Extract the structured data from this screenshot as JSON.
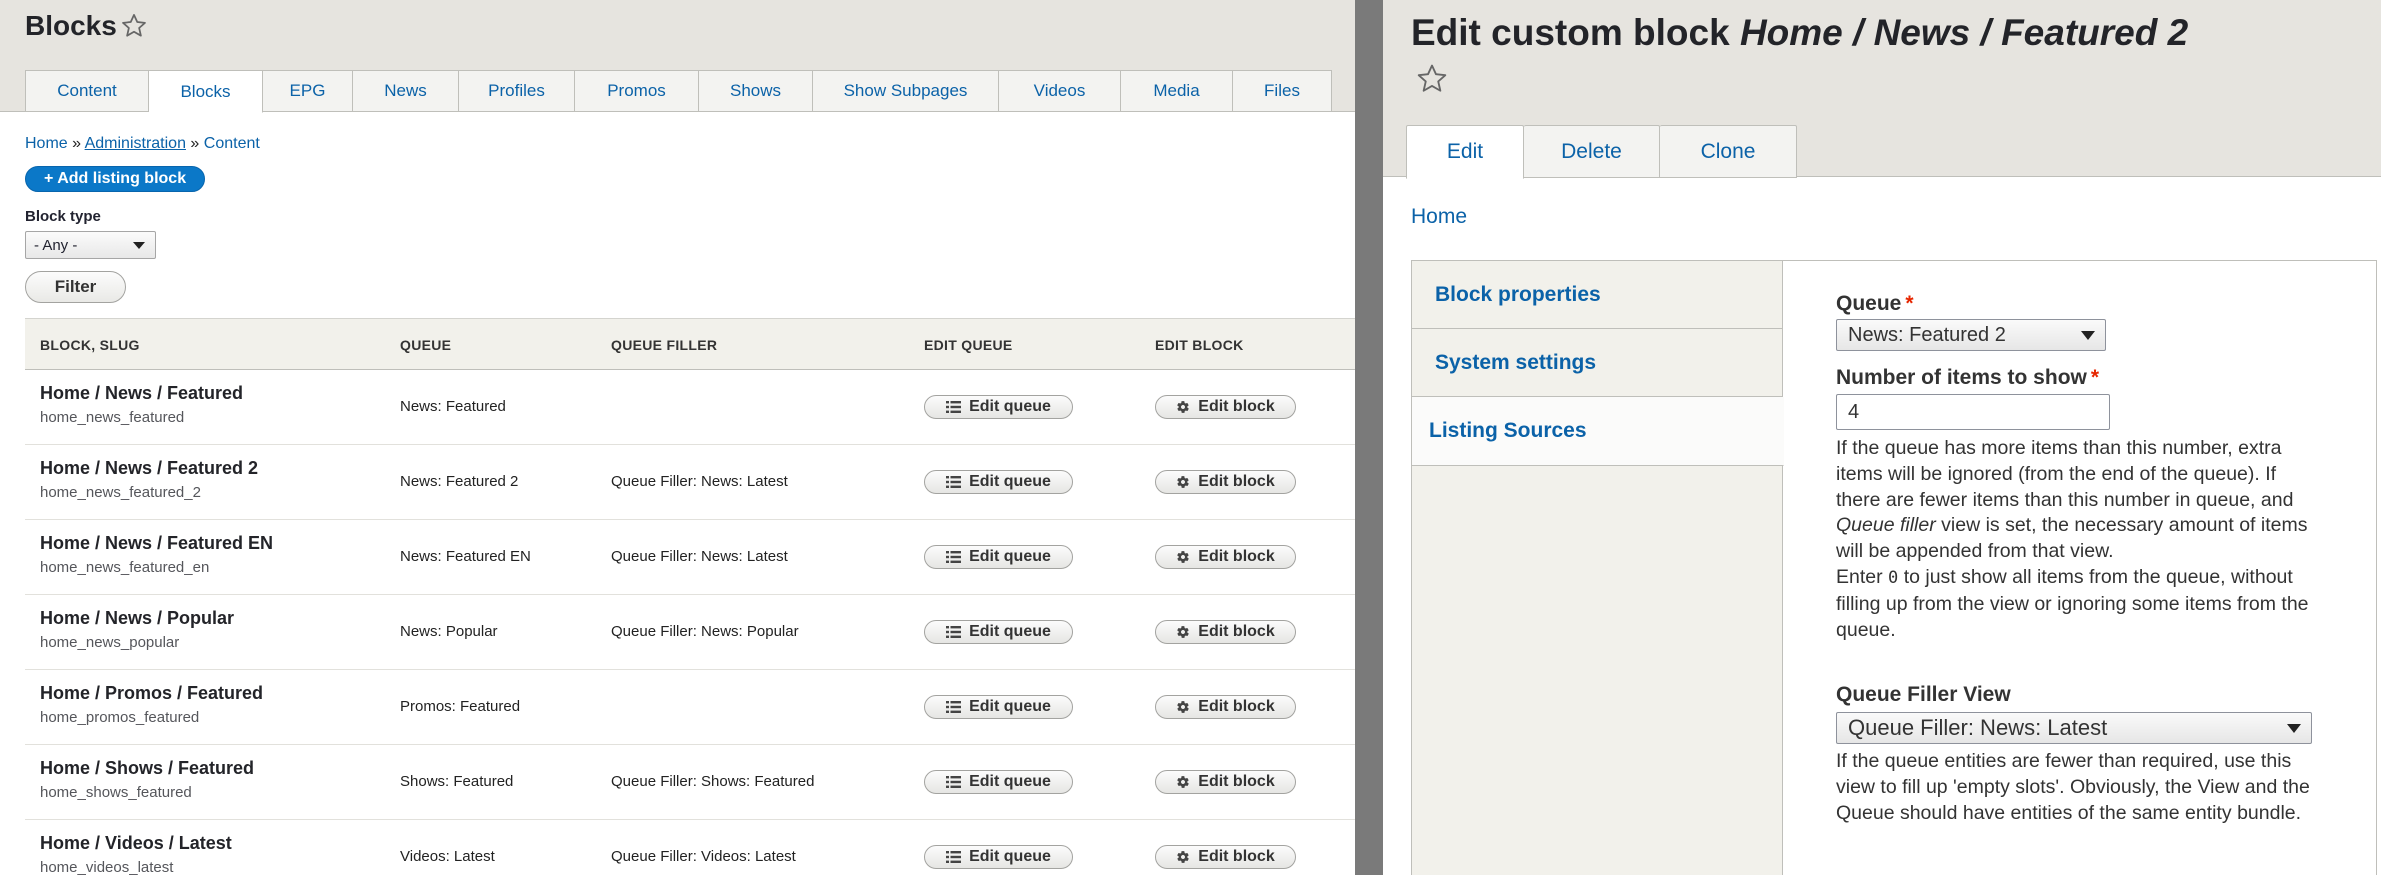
{
  "left": {
    "page_title": "Blocks",
    "tabs": [
      {
        "label": "Content",
        "w": 124
      },
      {
        "label": "Blocks",
        "w": 114,
        "active": true
      },
      {
        "label": "EPG",
        "w": 90
      },
      {
        "label": "News",
        "w": 106
      },
      {
        "label": "Profiles",
        "w": 116
      },
      {
        "label": "Promos",
        "w": 124
      },
      {
        "label": "Shows",
        "w": 114
      },
      {
        "label": "Show Subpages",
        "w": 186
      },
      {
        "label": "Videos",
        "w": 122
      },
      {
        "label": "Media",
        "w": 112
      },
      {
        "label": "Files",
        "w": 99
      }
    ],
    "breadcrumb": {
      "home": "Home",
      "sep1": " » ",
      "admin": "Administration",
      "sep2": " » ",
      "content": "Content"
    },
    "add_listing_label": "+ Add listing block",
    "block_type_label": "Block type",
    "block_type_value": "- Any -",
    "filter_label": "Filter",
    "table": {
      "headers": [
        "BLOCK, SLUG",
        "QUEUE",
        "QUEUE FILLER",
        "EDIT QUEUE",
        "EDIT BLOCK"
      ],
      "rows": [
        {
          "title": "Home / News / Featured",
          "slug": "home_news_featured",
          "queue": "News: Featured",
          "filler": "",
          "edit_queue": "Edit queue",
          "edit_block": "Edit block"
        },
        {
          "title": "Home / News / Featured 2",
          "slug": "home_news_featured_2",
          "queue": "News: Featured 2",
          "filler": "Queue Filler: News: Latest",
          "edit_queue": "Edit queue",
          "edit_block": "Edit block"
        },
        {
          "title": "Home / News / Featured EN",
          "slug": "home_news_featured_en",
          "queue": "News: Featured EN",
          "filler": "Queue Filler: News: Latest",
          "edit_queue": "Edit queue",
          "edit_block": "Edit block"
        },
        {
          "title": "Home / News / Popular",
          "slug": "home_news_popular",
          "queue": "News: Popular",
          "filler": "Queue Filler: News: Popular",
          "edit_queue": "Edit queue",
          "edit_block": "Edit block"
        },
        {
          "title": "Home / Promos / Featured",
          "slug": "home_promos_featured",
          "queue": "Promos: Featured",
          "filler": "",
          "edit_queue": "Edit queue",
          "edit_block": "Edit block"
        },
        {
          "title": "Home / Shows / Featured",
          "slug": "home_shows_featured",
          "queue": "Shows: Featured",
          "filler": "Queue Filler: Shows: Featured",
          "edit_queue": "Edit queue",
          "edit_block": "Edit block"
        },
        {
          "title": "Home / Videos / Latest",
          "slug": "home_videos_latest",
          "queue": "Videos: Latest",
          "filler": "Queue Filler: Videos: Latest",
          "edit_queue": "Edit queue",
          "edit_block": "Edit block"
        }
      ]
    }
  },
  "right": {
    "title_prefix": "Edit custom block ",
    "title_em": "Home / News / Featured 2",
    "tabs": [
      {
        "label": "Edit",
        "w": 118,
        "active": true
      },
      {
        "label": "Delete",
        "w": 136
      },
      {
        "label": "Clone",
        "w": 137
      }
    ],
    "home_link": "Home",
    "vertical_tabs": [
      {
        "label": "Block properties"
      },
      {
        "label": "System settings"
      },
      {
        "label": "Listing Sources",
        "active": true
      }
    ],
    "queue_label": "Queue",
    "queue_value": "News: Featured 2",
    "items_label": "Number of items to show",
    "items_value": "4",
    "items_desc_1a": "If the queue has more items than this number, extra items will be ignored (from the end of the queue). If there are fewer items than this number in queue, and ",
    "items_desc_1em": "Queue filler",
    "items_desc_1b": " view is set, the necessary amount of items will be appended from that view.",
    "items_desc_2a": "Enter ",
    "items_desc_2code": "0",
    "items_desc_2b": " to just show all items from the queue, without filling up from the view or ignoring some items from the queue.",
    "filler_label": "Queue Filler View",
    "filler_value": "Queue Filler: News: Latest",
    "filler_desc": "If the queue entities are fewer than required, use this view to fill up 'empty slots'. Obviously, the View and the Queue should have entities of the same entity bundle.",
    "required_mark": "*"
  },
  "colors": {
    "link": "#0b62a8",
    "primary_button": "#0b78c8",
    "required": "#e62600",
    "header_bg": "#e6e4df",
    "divider": "#7a7a7a"
  },
  "icons": [
    "star-icon",
    "list-icon",
    "gear-icon",
    "chevron-down-icon"
  ]
}
